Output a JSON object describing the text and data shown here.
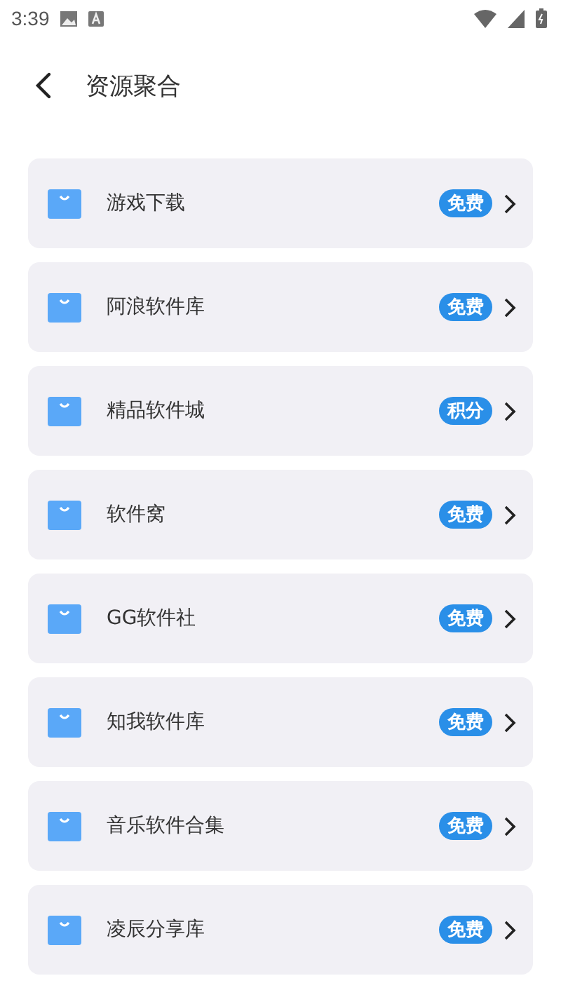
{
  "status_bar": {
    "time": "3:39"
  },
  "header": {
    "title": "资源聚合"
  },
  "items": [
    {
      "name": "游戏下载",
      "badge": "免费"
    },
    {
      "name": "阿浪软件库",
      "badge": "免费"
    },
    {
      "name": "精品软件城",
      "badge": "积分"
    },
    {
      "name": "软件窝",
      "badge": "免费"
    },
    {
      "name": "GG软件社",
      "badge": "免费"
    },
    {
      "name": "知我软件库",
      "badge": "免费"
    },
    {
      "name": "音乐软件合集",
      "badge": "免费"
    },
    {
      "name": "凌辰分享库",
      "badge": "免费"
    }
  ]
}
